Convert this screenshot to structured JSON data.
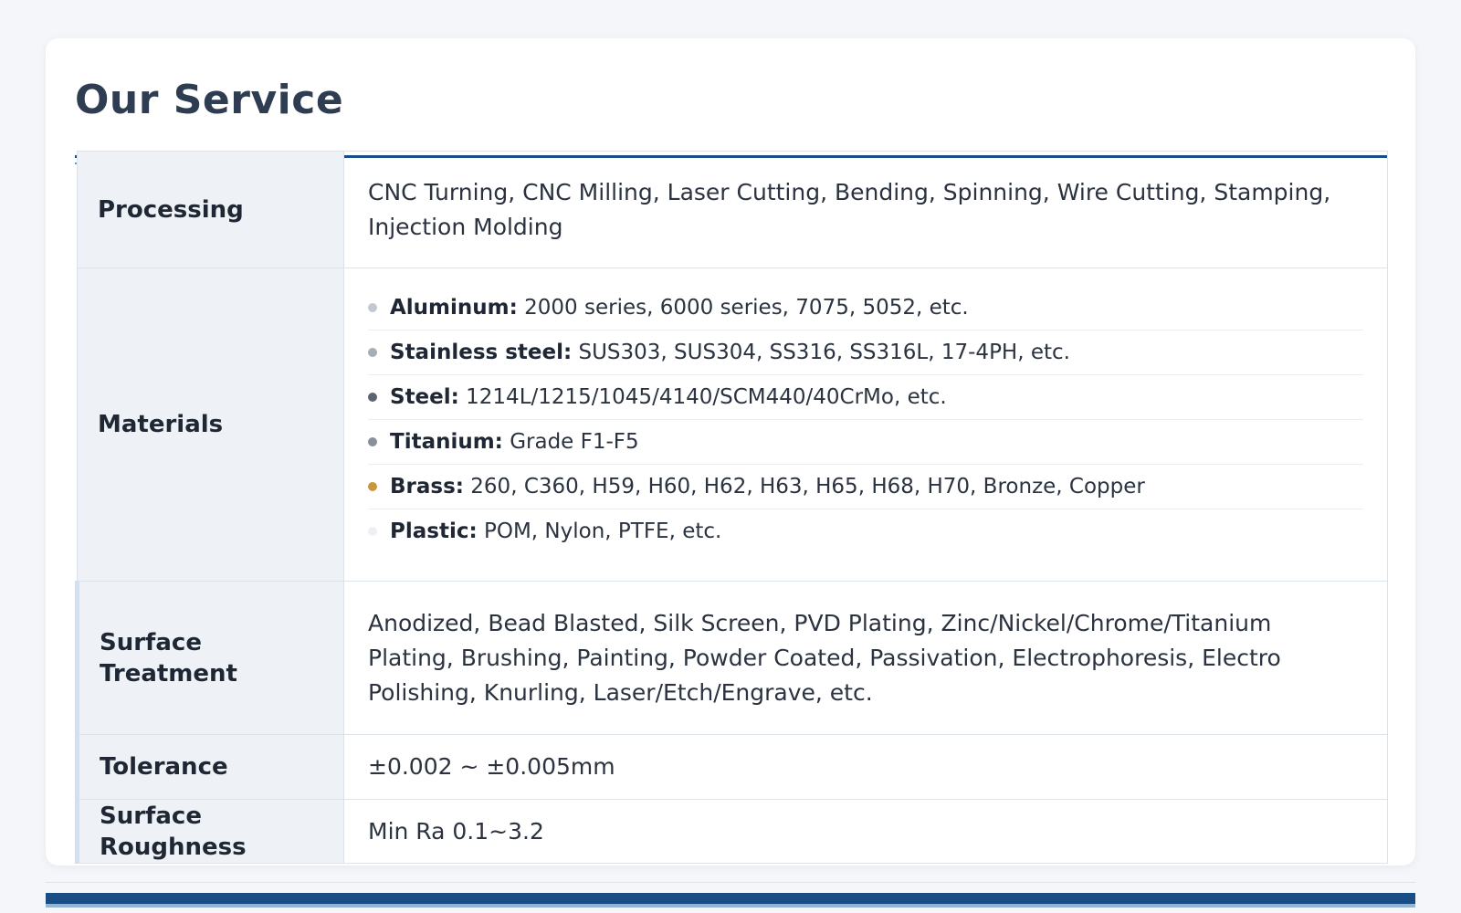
{
  "page_title": "Our Service",
  "rows": [
    {
      "label": "Processing",
      "value": "CNC Turning, CNC Milling, Laser Cutting, Bending, Spinning, Wire Cutting, Stamping, Injection Molding"
    },
    {
      "label": "Materials"
    },
    {
      "label": "Surface Treatment",
      "value": "Anodized, Bead Blasted, Silk Screen, PVD Plating, Zinc/Nickel/Chrome/Titanium Plating, Brushing, Painting, Powder Coated, Passivation, Electrophoresis, Electro Polishing, Knurling, Laser/Etch/Engrave, etc."
    },
    {
      "label": "Tolerance",
      "value": "±0.002 ~ ±0.005mm"
    },
    {
      "label": "Surface Roughness",
      "value": "Min Ra 0.1~3.2"
    }
  ],
  "materials": [
    {
      "name": "Aluminum:",
      "detail": " 2000 series, 6000 series, 7075, 5052, etc.",
      "dot_color": "#c3c9d1",
      "icon": "bullet-dot"
    },
    {
      "name": "Stainless steel:",
      "detail": " SUS303, SUS304, SS316, SS316L, 17-4PH, etc.",
      "dot_color": "#a8aeb6",
      "icon": "bullet-dot"
    },
    {
      "name": "Steel:",
      "detail": " 1214L/1215/1045/4140/SCM440/40CrMo, etc.",
      "dot_color": "#5b6470",
      "icon": "bullet-dot"
    },
    {
      "name": "Titanium:",
      "detail": " Grade F1-F5",
      "dot_color": "#8a8f98",
      "icon": "bullet-dot"
    },
    {
      "name": "Brass:",
      "detail": " 260, C360, H59, H60, H62, H63, H65, H68, H70, Bronze, Copper",
      "dot_color": "#c9963a",
      "icon": "bullet-dot"
    },
    {
      "name": "Plastic:",
      "detail": " POM, Nylon, PTFE, etc.",
      "dot_color": "#eef0f3",
      "icon": "bullet-dot"
    }
  ],
  "colors": {
    "accent": "#1a4d85",
    "accent_light": "#5b9bd5",
    "label_bg": "#eef2f7",
    "title_text": "#2e3d52"
  }
}
